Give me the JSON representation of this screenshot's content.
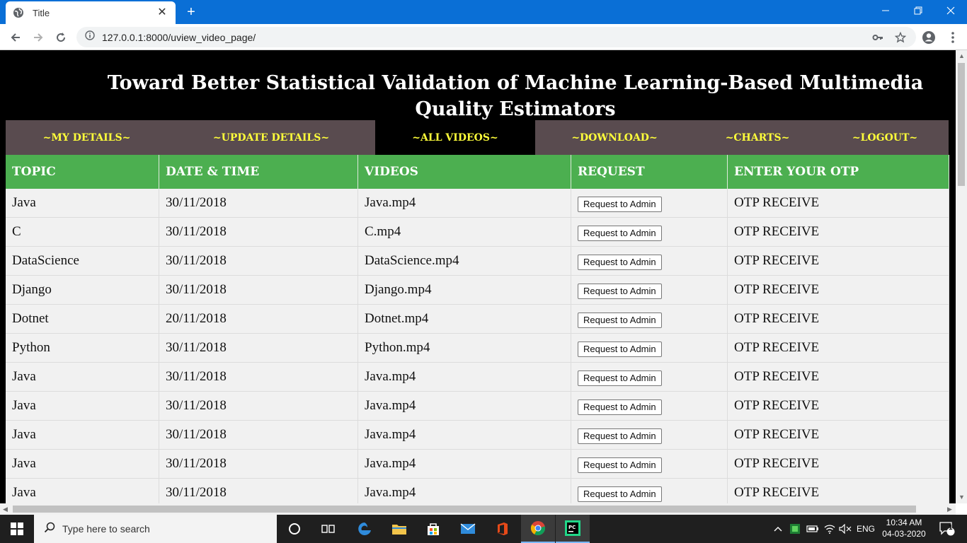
{
  "browser": {
    "tab_title": "Title",
    "url": "127.0.0.1:8000/uview_video_page/"
  },
  "page": {
    "title": "Toward Better Statistical Validation of Machine Learning-Based Multimedia Quality Estimators",
    "menu": [
      {
        "label": "~MY DETAILS~",
        "active": false
      },
      {
        "label": "~UPDATE DETAILS~",
        "active": false
      },
      {
        "label": "~ALL VIDEOS~",
        "active": true
      },
      {
        "label": "~DOWNLOAD~",
        "active": false
      },
      {
        "label": "~CHARTS~",
        "active": false
      },
      {
        "label": "~LOGOUT~",
        "active": false
      }
    ],
    "table": {
      "headers": [
        "TOPIC",
        "DATE & TIME",
        "VIDEOS",
        "REQUEST",
        "ENTER YOUR OTP"
      ],
      "button_label": "Request to Admin",
      "rows": [
        {
          "topic": "Java",
          "date": "30/11/2018",
          "video": "Java.mp4",
          "otp": "OTP RECEIVE"
        },
        {
          "topic": "C",
          "date": "30/11/2018",
          "video": "C.mp4",
          "otp": "OTP RECEIVE"
        },
        {
          "topic": "DataScience",
          "date": "30/11/2018",
          "video": "DataScience.mp4",
          "otp": "OTP RECEIVE"
        },
        {
          "topic": "Django",
          "date": "30/11/2018",
          "video": "Django.mp4",
          "otp": "OTP RECEIVE"
        },
        {
          "topic": "Dotnet",
          "date": "20/11/2018",
          "video": "Dotnet.mp4",
          "otp": "OTP RECEIVE"
        },
        {
          "topic": "Python",
          "date": "30/11/2018",
          "video": "Python.mp4",
          "otp": "OTP RECEIVE"
        },
        {
          "topic": "Java",
          "date": "30/11/2018",
          "video": "Java.mp4",
          "otp": "OTP RECEIVE"
        },
        {
          "topic": "Java",
          "date": "30/11/2018",
          "video": "Java.mp4",
          "otp": "OTP RECEIVE"
        },
        {
          "topic": "Java",
          "date": "30/11/2018",
          "video": "Java.mp4",
          "otp": "OTP RECEIVE"
        },
        {
          "topic": "Java",
          "date": "30/11/2018",
          "video": "Java.mp4",
          "otp": "OTP RECEIVE"
        },
        {
          "topic": "Java",
          "date": "30/11/2018",
          "video": "Java.mp4",
          "otp": "OTP RECEIVE"
        }
      ]
    }
  },
  "taskbar": {
    "search_placeholder": "Type here to search",
    "language": "ENG",
    "time": "10:34 AM",
    "date": "04-03-2020",
    "notification_count": "1",
    "apps": [
      "task-view-icon",
      "edge-icon",
      "file-explorer-icon",
      "store-icon",
      "mail-icon",
      "office-icon",
      "chrome-icon",
      "pycharm-icon"
    ]
  },
  "colors": {
    "tabbar": "#0a6fd6",
    "menu_bg": "#594b4f",
    "menu_text": "#ffff3a",
    "table_header": "#4caf50",
    "row_bg": "#f1f1f1"
  }
}
